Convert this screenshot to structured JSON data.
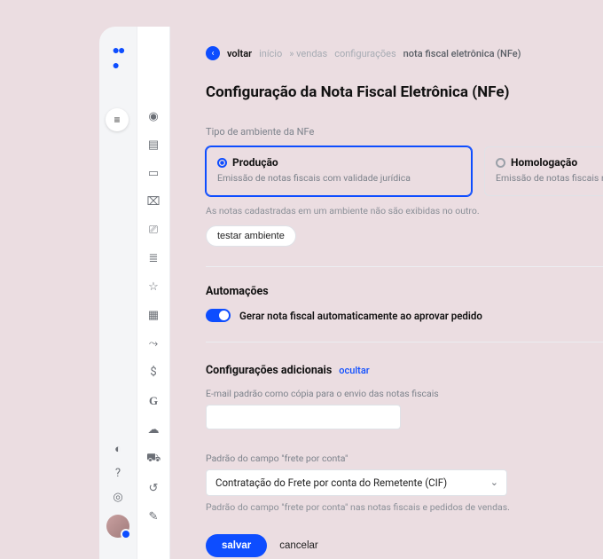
{
  "back_label": "voltar",
  "breadcrumbs": {
    "a": "início",
    "b": "vendas",
    "c": "configurações",
    "d": "nota fiscal eletrônica (NFe)"
  },
  "title": "Configuração da Nota Fiscal Eletrônica (NFe)",
  "env": {
    "label": "Tipo de ambiente da NFe",
    "prod": {
      "title": "Produção",
      "desc": "Emissão de notas fiscais com validade jurídica"
    },
    "homolog": {
      "title": "Homologação",
      "desc": "Emissão de notas fiscais no ambiente de testes"
    },
    "hint": "As notas cadastradas em um ambiente não são exibidas no outro.",
    "test_btn": "testar ambiente"
  },
  "automations": {
    "heading": "Automações",
    "toggle_label": "Gerar nota fiscal automaticamente ao aprovar pedido"
  },
  "additional": {
    "heading": "Configurações adicionais",
    "toggle_link": "ocultar",
    "email_label": "E-mail padrão como cópia para o envio das notas fiscais",
    "email_value": "",
    "frete_label": "Padrão do campo \"frete por conta\"",
    "frete_value": "Contratação do Frete por conta do Remetente (CIF)",
    "frete_hint": "Padrão do campo \"frete por conta\" nas notas fiscais e pedidos de vendas."
  },
  "actions": {
    "save": "salvar",
    "cancel": "cancelar"
  },
  "icons": {
    "logo": "⬤⬤",
    "hamburger": "≡",
    "contrast": "◐",
    "help": "?",
    "bell": "◎",
    "eye": "◉",
    "doc": "▤",
    "box": "▭",
    "briefcase": "⌧",
    "inbox": "⎚",
    "bars": "≣",
    "star": "☆",
    "grid": "▦",
    "chart": "⤳",
    "dollar": "$",
    "g": "G",
    "cloud": "☁",
    "truck": "⛟",
    "undo": "↺",
    "paper": "✎"
  }
}
